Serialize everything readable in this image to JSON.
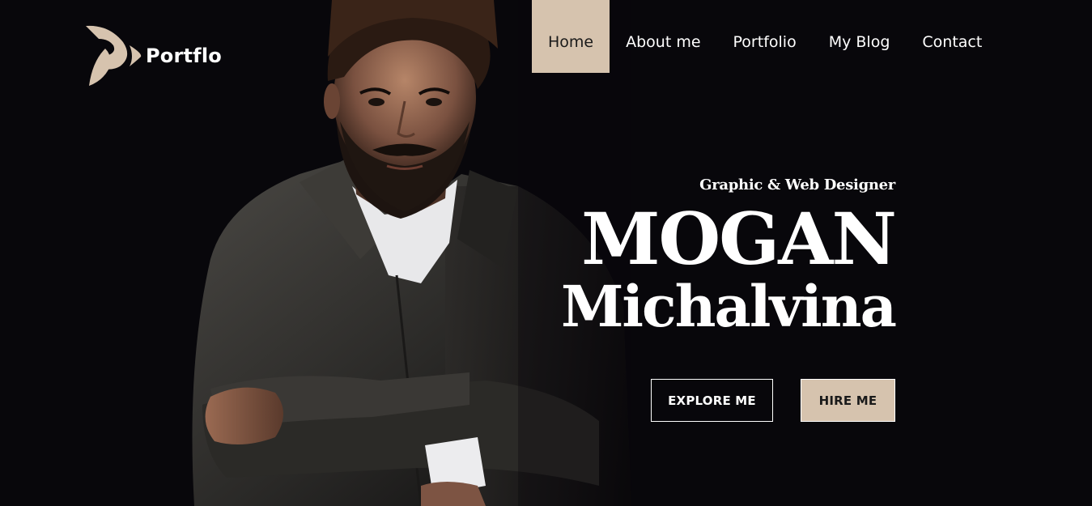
{
  "brand": {
    "name": "Portflo",
    "icon": "portflo-logo-icon",
    "accent_color": "#d6c3ae"
  },
  "nav": {
    "items": [
      {
        "label": "Home",
        "active": true
      },
      {
        "label": "About me",
        "active": false
      },
      {
        "label": "Portfolio",
        "active": false
      },
      {
        "label": "My Blog",
        "active": false
      },
      {
        "label": "Contact",
        "active": false
      }
    ]
  },
  "hero": {
    "subtitle": "Graphic & Web Designer",
    "first_name": "MOGAN",
    "last_name": "Michalvina",
    "background_color": "#08070b"
  },
  "buttons": {
    "explore": "EXPLORE ME",
    "hire": "HIRE ME"
  }
}
